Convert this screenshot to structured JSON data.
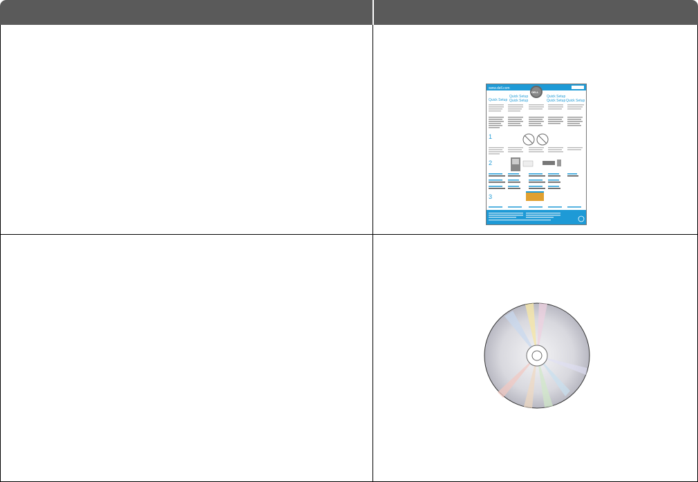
{
  "table": {
    "header": {
      "col1": "",
      "col2": ""
    },
    "rows": [
      {
        "description": "",
        "illustration": "quick-setup-sheet"
      },
      {
        "description": "",
        "illustration": "software-cd"
      }
    ]
  },
  "sheet": {
    "url": "www.dell.com",
    "title": "Quick Setup",
    "step1": "1",
    "step2": "2",
    "step3": "3",
    "accent_color": "#1e9ad6"
  },
  "colors": {
    "header_bg": "#5a5a5a",
    "border": "#000000"
  }
}
